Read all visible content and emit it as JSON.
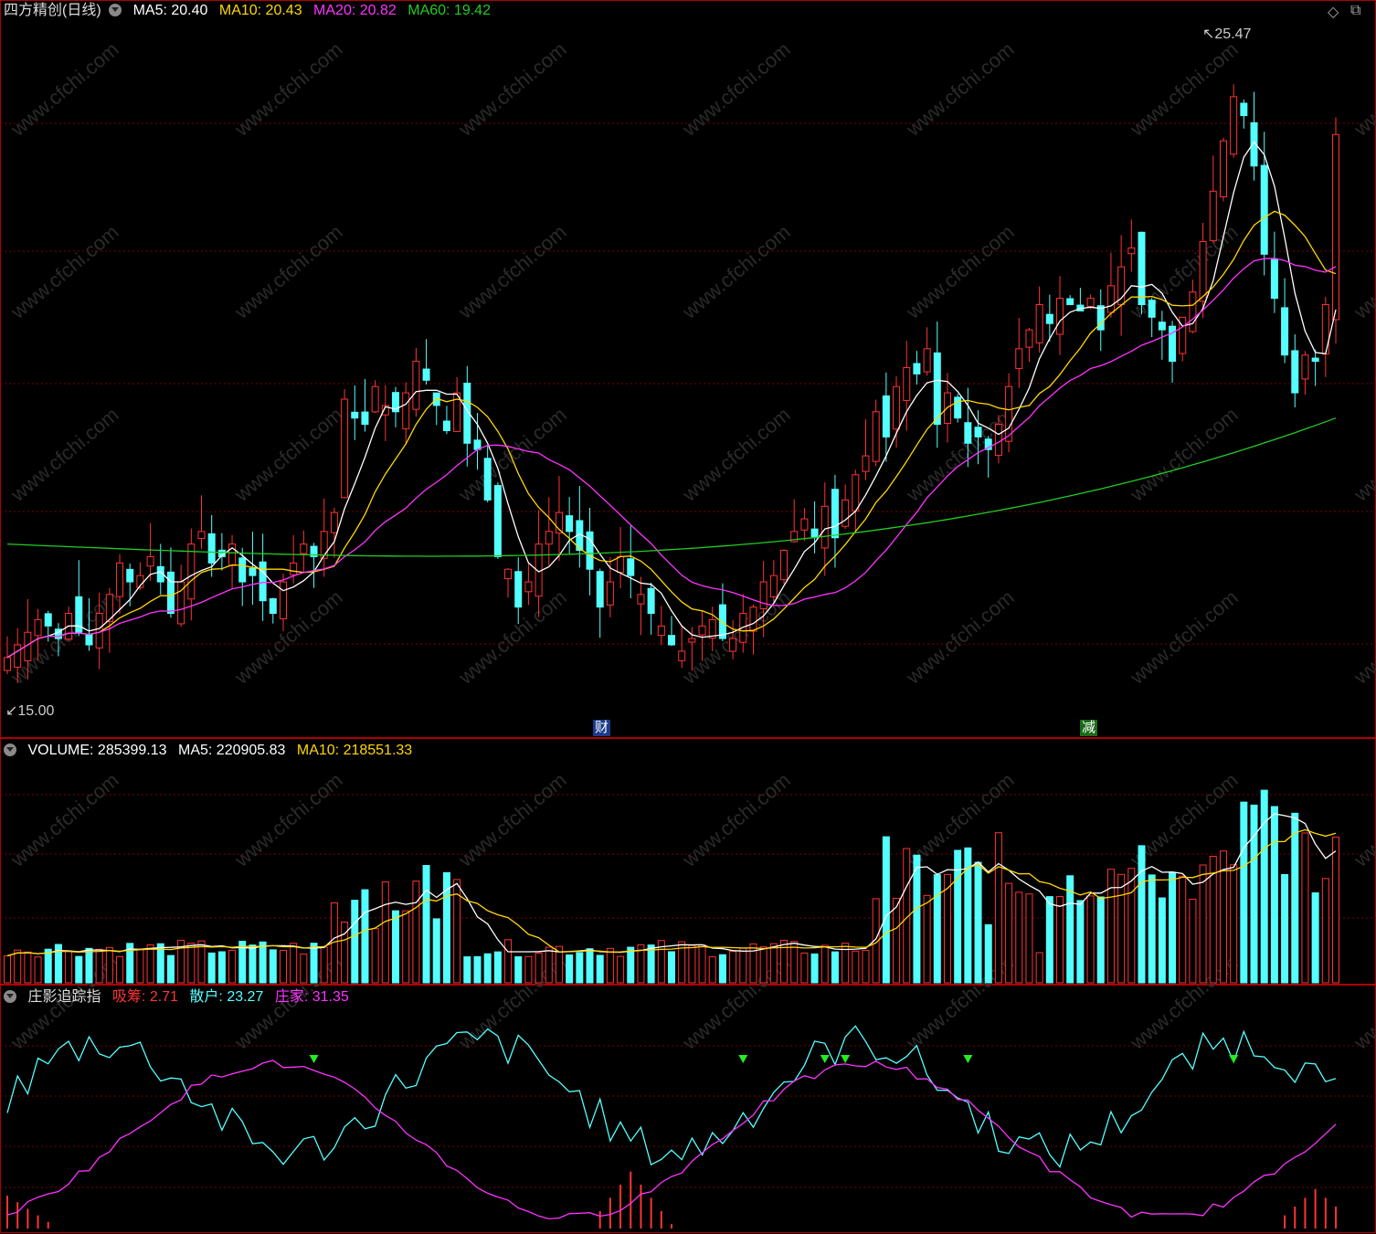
{
  "main_panel": {
    "title": "四方精创(日线)",
    "ma5": "MA5: 20.40",
    "ma10": "MA10: 20.43",
    "ma20": "MA20: 20.82",
    "ma60": "MA60: 19.42",
    "high_label": "25.47",
    "low_label": "15.00",
    "event_tag_1": "财",
    "event_tag_2": "减"
  },
  "volume_panel": {
    "volume": "VOLUME: 285399.13",
    "ma5": "MA5: 220905.83",
    "ma10": "MA10: 218551.33"
  },
  "indicator_panel": {
    "title": "庄影追踪指",
    "xichou": "吸筹: 2.71",
    "sanhu": "散户: 23.27",
    "zhuangjia": "庄家: 31.35"
  },
  "colors": {
    "up": "#ff3333",
    "down": "#54ffff",
    "ma5": "#ffffff",
    "ma10": "#ffd700",
    "ma20": "#ff33ff",
    "ma60": "#22cc22",
    "border": "#b00000",
    "grid": "#7a0000"
  },
  "icons": [
    "collapse-circle-icon",
    "diamond-icon",
    "restore-icon"
  ],
  "chart_data": [
    {
      "type": "candlestick",
      "title": "四方精创(日线)",
      "ylim": [
        15.0,
        25.47
      ],
      "series": [
        {
          "name": "MA5",
          "last": 20.4
        },
        {
          "name": "MA10",
          "last": 20.43
        },
        {
          "name": "MA20",
          "last": 20.82
        },
        {
          "name": "MA60",
          "last": 19.42
        }
      ],
      "close": [
        15.6,
        15.8,
        16.0,
        16.2,
        16.1,
        15.9,
        16.3,
        16.0,
        15.8,
        16.3,
        16.6,
        17.1,
        16.8,
        16.9,
        17.2,
        16.8,
        16.3,
        16.8,
        17.4,
        17.6,
        17.1,
        17.2,
        17.4,
        16.8,
        16.9,
        16.5,
        16.3,
        16.8,
        17.1,
        17.4,
        17.2,
        17.6,
        17.9,
        19.7,
        19.4,
        19.3,
        19.9,
        19.6,
        19.5,
        19.8,
        20.3,
        20.0,
        19.6,
        19.2,
        19.8,
        19.0,
        18.9,
        18.1,
        17.2,
        17.0,
        16.4,
        16.8,
        17.4,
        17.6,
        17.9,
        17.6,
        17.3,
        17.0,
        16.4,
        16.8,
        17.2,
        16.9,
        16.6,
        16.3,
        16.1,
        15.8,
        15.7,
        15.9,
        16.1,
        16.2,
        15.9,
        15.9,
        16.3,
        16.4,
        16.8,
        16.9,
        17.3,
        17.6,
        17.8,
        17.5,
        18.0,
        17.5,
        18.1,
        18.5,
        18.8,
        19.5,
        19.1,
        19.9,
        20.2,
        20.1,
        20.5,
        19.3,
        19.8,
        19.4,
        19.0,
        19.1,
        18.9,
        19.3,
        19.9,
        20.5,
        20.8,
        21.2,
        20.9,
        21.3,
        21.2,
        21.1,
        21.3,
        20.8,
        21.5,
        21.8,
        22.1,
        21.2,
        21.0,
        20.8,
        20.3,
        21.0,
        21.4,
        22.2,
        23.0,
        23.8,
        24.5,
        24.2,
        23.4,
        22.0,
        21.3,
        20.4,
        19.8,
        20.4,
        20.3,
        21.2,
        23.9
      ],
      "high_label": 25.47,
      "low_label": 15.0,
      "event_markers": [
        "财",
        "减"
      ]
    },
    {
      "type": "bar",
      "title": "VOLUME",
      "series": [
        {
          "name": "VOLUME",
          "last": 285399.13
        },
        {
          "name": "MA5",
          "last": 220905.83
        },
        {
          "name": "MA10",
          "last": 218551.33
        }
      ]
    },
    {
      "type": "line",
      "title": "庄影追踪指",
      "series": [
        {
          "name": "吸筹",
          "last": 2.71
        },
        {
          "name": "散户",
          "last": 23.27
        },
        {
          "name": "庄家",
          "last": 31.35
        }
      ]
    }
  ]
}
